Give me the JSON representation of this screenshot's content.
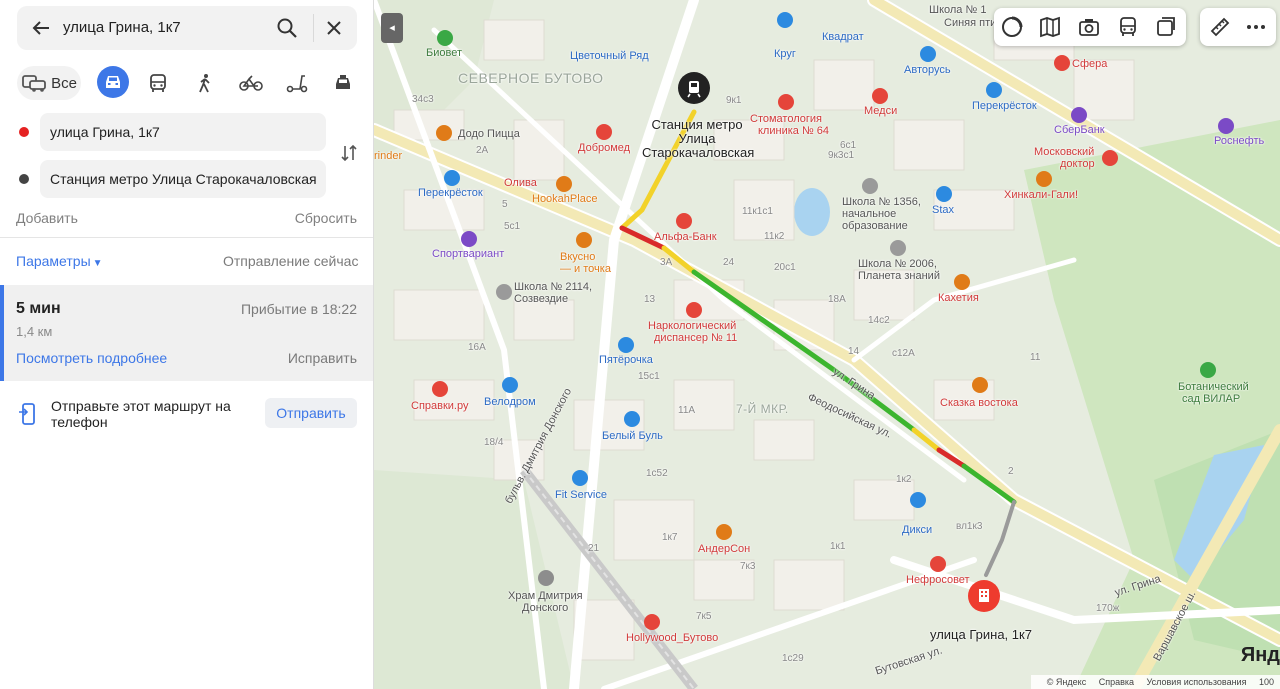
{
  "search": {
    "query": "улица Грина, 1к7"
  },
  "modes": {
    "all_label": "Все"
  },
  "route": {
    "from": "улица Грина, 1к7",
    "to": "Станция метро Улица Старокачаловская",
    "add_label": "Добавить",
    "reset_label": "Сбросить",
    "params_label": "Параметры",
    "depart_label": "Отправление сейчас"
  },
  "result": {
    "time": "5 мин",
    "distance": "1,4 км",
    "arrival": "Прибытие в 18:22",
    "details_label": "Посмотреть подробнее",
    "fix_label": "Исправить"
  },
  "send": {
    "text": "Отправьте этот маршрут на телефон",
    "button": "Отправить"
  },
  "map": {
    "metro_label": "Станция метро Улица Старокачаловская",
    "dest_label": "улица Грина, 1к7",
    "districts": [
      "СЕВЕРНОЕ БУТОВО",
      "7-Й МКР."
    ],
    "streets": [
      "ул. Грина",
      "Феодосийская ул.",
      "бульв. Дмитрия Донского",
      "Варшавское ш.",
      "Бутовская ул."
    ],
    "pois": {
      "bioved": "Биовет",
      "flowers": "Цветочный Ряд",
      "krug": "Круг",
      "kvadrat": "Квадрат",
      "school1": "Школа № 1",
      "school1b": "Синяя пти",
      "sfera": "Сфера",
      "avtorus": "Авторусь",
      "dodo": "Додо Пицца",
      "dentist": "Стоматология",
      "dentist_b": "клиника № 64",
      "medsi": "Медси",
      "perek1": "Перекрёсток",
      "sberbank": "СберБанк",
      "rosneft": "Роснефть",
      "dobromed": "Добромед",
      "olive": "Олива",
      "hookah": "HookahPlace",
      "moscow_doc": "Московский",
      "moscow_doc_b": "доктор",
      "hinkali": "Хинкали-Гали!",
      "school1356": "Школа № 1356,",
      "school1356_b": "начальное",
      "school1356_c": "образование",
      "stax": "Stax",
      "perek2": "Перекрёсток",
      "alfa": "Альфа-Банк",
      "sportvariant": "Спортвариант",
      "vkusno": "Вкусно",
      "vkusno_b": "— и точка",
      "school2006": "Школа № 2006,",
      "school2006_b": "Планета знаний",
      "kahetia": "Кахетия",
      "school2114": "Школа № 2114,",
      "school2114_b": "Созвездие",
      "narko": "Наркологический",
      "narko_b": "диспансер № 11",
      "pyaterochka": "Пятёрочка",
      "spravki": "Справки.ру",
      "velodrom": "Велодром",
      "belyi_bul": "Белый Буль",
      "skazka": "Сказка востока",
      "botsad": "Ботанический",
      "botsad_b": "сад ВИЛАР",
      "fit": "Fit Service",
      "dixy": "Дикси",
      "anderson": "АндерСон",
      "neftsovet": "Нефросовет",
      "hram": "Храм Дмитрия",
      "hram_b": "Донского",
      "hollywood": "Hollywood_Бутово",
      "grinder": "rinder"
    },
    "buildings": [
      "1к7",
      "1с52",
      "21",
      "7к3",
      "7к5",
      "1с29",
      "13",
      "3А",
      "24",
      "18А",
      "14с2",
      "14",
      "с12А",
      "11",
      "1к2",
      "вл1к3",
      "2",
      "170ж",
      "16А",
      "11А",
      "15с1",
      "5",
      "2А",
      "9к1",
      "6с1",
      "9к3с1",
      "11к1с1",
      "11к2",
      "20с1",
      "18/4",
      "5с1",
      "34с3",
      "1к1"
    ]
  },
  "footer": {
    "copy": "© Яндекс",
    "help": "Справка",
    "terms": "Условия использования",
    "scale": "100"
  },
  "brand": "Янд",
  "colors": {
    "accent": "#3d77e7",
    "route_green": "#3cb52e",
    "route_red": "#d92a2a",
    "route_yellow": "#f2d22a",
    "start_dot": "#e52222"
  }
}
